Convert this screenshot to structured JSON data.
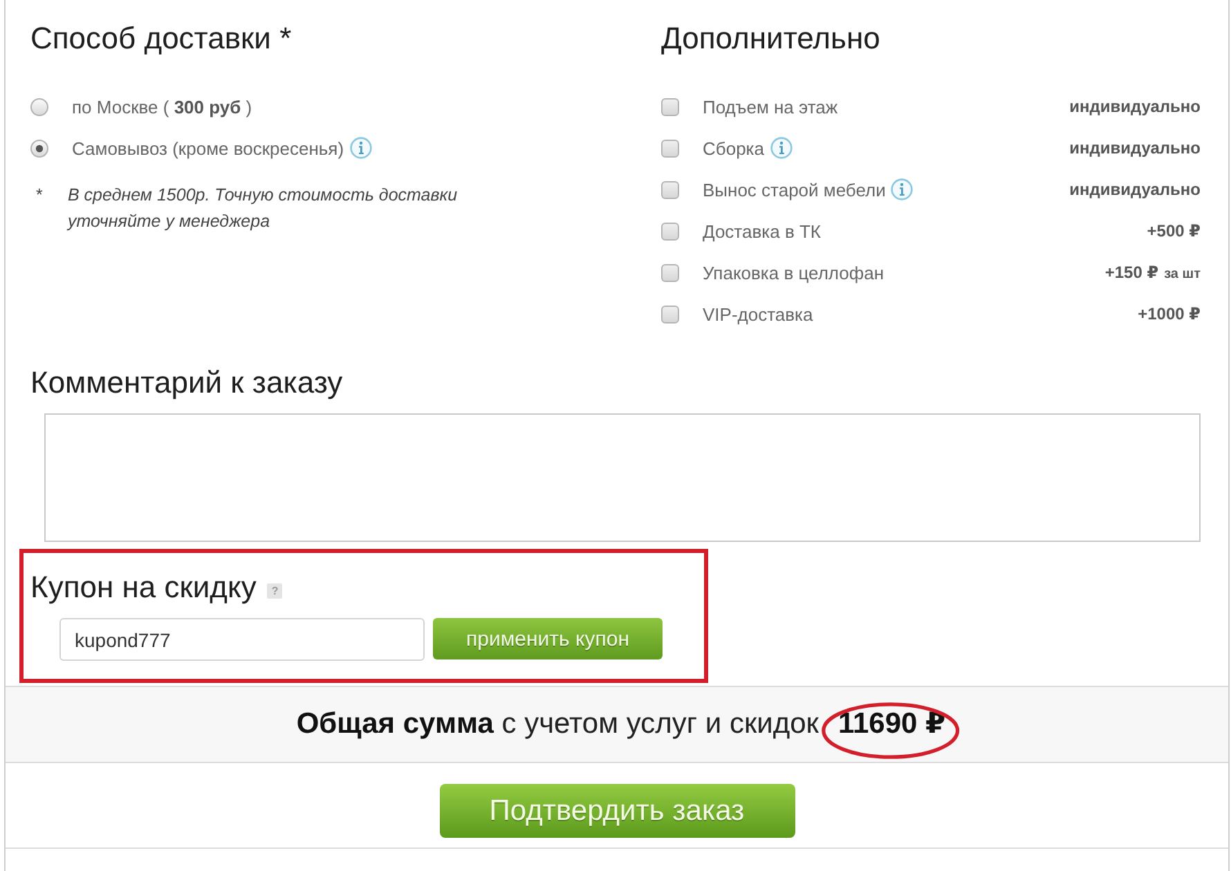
{
  "delivery": {
    "title": "Способ доставки *",
    "options": [
      {
        "label": "по Москве ( **300 руб** )",
        "selected": false,
        "info": false
      },
      {
        "label": "Самовывоз (кроме воскресенья)",
        "selected": true,
        "info": true
      }
    ],
    "footnote_mark": "*",
    "footnote": "В среднем 1500р. Точную стоимость доставки уточняйте у менеджера"
  },
  "extras": {
    "title": "Дополнительно",
    "items": [
      {
        "label": "Подъем на этаж",
        "checked": false,
        "info": false,
        "price": "индивидуально"
      },
      {
        "label": "Сборка",
        "checked": false,
        "info": true,
        "price": "индивидуально"
      },
      {
        "label": "Вынос старой мебели",
        "checked": false,
        "info": true,
        "price": "индивидуально"
      },
      {
        "label": "Доставка в ТК",
        "checked": false,
        "info": false,
        "price": "+500 ₽"
      },
      {
        "label": "Упаковка в целлофан",
        "checked": false,
        "info": false,
        "price": "+150 ₽",
        "price_note": "за шт"
      },
      {
        "label": "VIP-доставка",
        "checked": false,
        "info": false,
        "price": "+1000 ₽"
      }
    ]
  },
  "comment": {
    "title": "Комментарий к заказу"
  },
  "coupon": {
    "title": "Купон на скидку",
    "help": "?",
    "value": "kupond777",
    "button": "применить купон",
    "highlighted": true
  },
  "total": {
    "label": "**Общая сумма** с учетом услуг и скидок",
    "amount": "11690 ₽",
    "amount_highlighted": true
  },
  "submit": "Подтвердить заказ"
}
